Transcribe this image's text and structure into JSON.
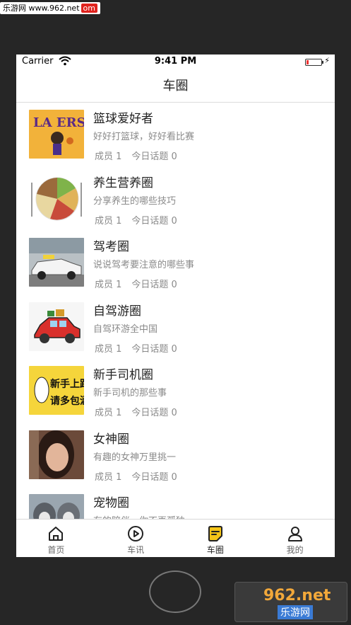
{
  "watermark": {
    "site": "乐游网 www.962.net",
    "badge": "om",
    "brand": "962.net",
    "brand_cn": "乐游网"
  },
  "status_bar": {
    "carrier": "Carrier",
    "time": "9:41 PM",
    "battery_level": 0.15
  },
  "nav": {
    "title": "车圈"
  },
  "circles": [
    {
      "title": "篮球爱好者",
      "desc": "好好打篮球，好好看比赛",
      "members": "成员 1",
      "topics": "今日话题 0",
      "thumb_icon": "basketball-poster-icon"
    },
    {
      "title": "养生营养圈",
      "desc": "分享养生的哪些技巧",
      "members": "成员 1",
      "topics": "今日话题 0",
      "thumb_icon": "food-plate-icon"
    },
    {
      "title": "驾考圈",
      "desc": "说说驾考要注意的哪些事",
      "members": "成员 1",
      "topics": "今日话题 0",
      "thumb_icon": "driving-test-car-icon"
    },
    {
      "title": "自驾游圈",
      "desc": "自驾环游全中国",
      "members": "成员 1",
      "topics": "今日话题 0",
      "thumb_icon": "red-car-icon"
    },
    {
      "title": "新手司机圈",
      "desc": "新手司机的那些事",
      "members": "成员 1",
      "topics": "今日话题 0",
      "thumb_icon": "novice-driver-sign-icon",
      "thumb_text": [
        "新手上路",
        "请多包涵"
      ]
    },
    {
      "title": "女神圈",
      "desc": "有趣的女神万里挑一",
      "members": "成员 1",
      "topics": "今日话题 0",
      "thumb_icon": "woman-photo-icon"
    },
    {
      "title": "宠物圈",
      "desc": "有的陪伴，你不再孤独",
      "members": "",
      "topics": "",
      "thumb_icon": "pet-photo-icon"
    }
  ],
  "tabs": [
    {
      "label": "首页",
      "icon": "home-icon",
      "active": false
    },
    {
      "label": "车讯",
      "icon": "play-circle-icon",
      "active": false
    },
    {
      "label": "车圈",
      "icon": "note-icon",
      "active": true
    },
    {
      "label": "我的",
      "icon": "person-icon",
      "active": false
    }
  ],
  "colors": {
    "accent": "#f5c518",
    "text": "#222222",
    "muted": "#8a8a8a",
    "divider": "#dcdcdc"
  }
}
